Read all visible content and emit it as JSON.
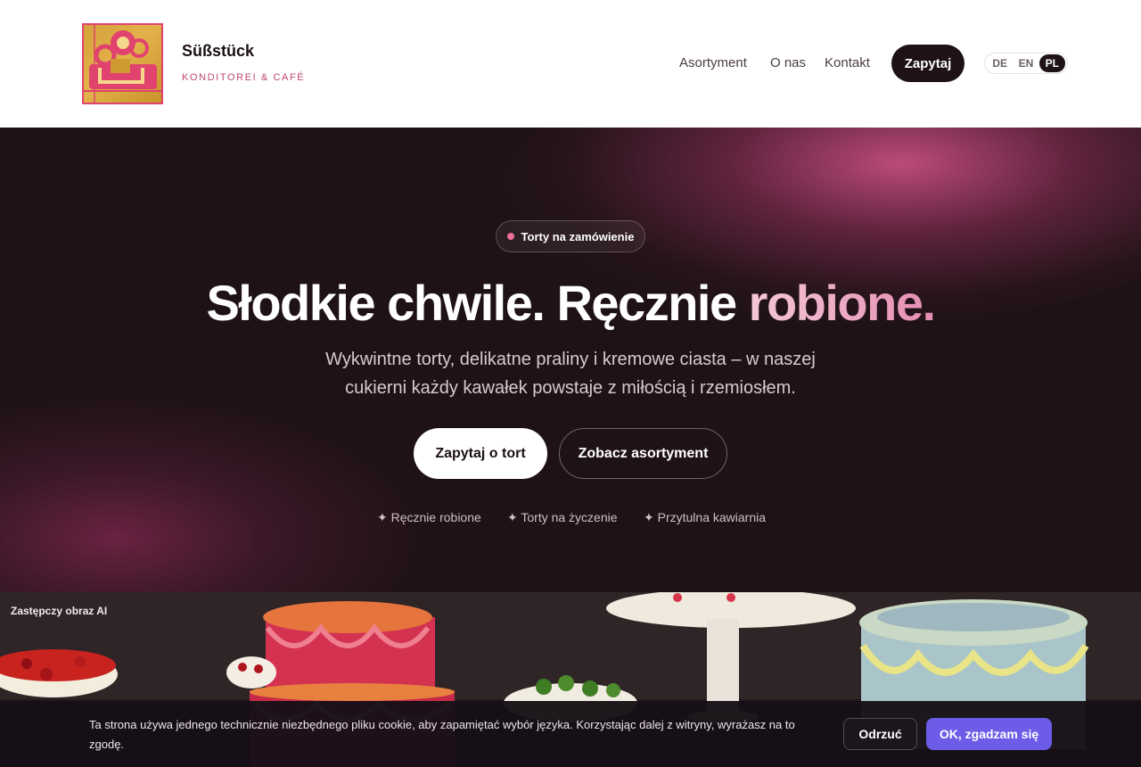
{
  "brand": {
    "name": "Süßstück",
    "tagline": "KONDITOREI & CAFÉ"
  },
  "nav": {
    "links": [
      "Asortyment",
      "O nas",
      "Kontakt"
    ],
    "cta": "Zapytaj",
    "languages": [
      "DE",
      "EN",
      "PL"
    ],
    "active_language": "PL"
  },
  "hero": {
    "badge": "Torty na zamówienie",
    "title_main": "Słodkie chwile. Ręcznie ",
    "title_accent": "robione.",
    "subtitle": "Wykwintne torty, delikatne praliny i kremowe ciasta – w naszej cukierni każdy kawałek powstaje z miłością i rzemiosłem.",
    "primary_button": "Zapytaj o tort",
    "secondary_button": "Zobacz asortyment",
    "features": [
      "✦ Ręcznie robione",
      "✦ Torty na życzenie",
      "✦ Przytulna kawiarnia"
    ]
  },
  "photo": {
    "label": "Zastępczy obraz AI"
  },
  "cookie": {
    "text": "Ta strona używa jednego technicznie niezbędnego pliku cookie, aby zapamiętać wybór języka. Korzystając dalej z witryny, wyrażasz na to zgodę.",
    "reject": "Odrzuć",
    "accept": "OK, zgadzam się"
  },
  "colors": {
    "accent": "#c0476c",
    "dark": "#1e1216",
    "cookie_accept": "#6c5ce7"
  }
}
